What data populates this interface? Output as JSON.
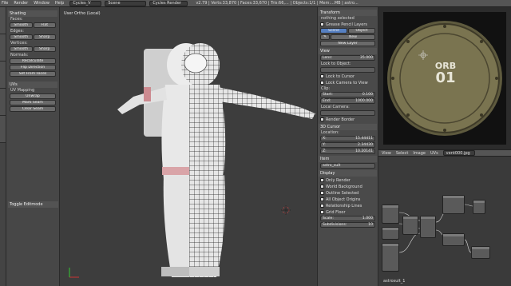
{
  "topbar": {
    "menus": [
      "File",
      "Render",
      "Window",
      "Help"
    ],
    "layout": "Cycles_V",
    "scene": "Scene",
    "engine": "Cycles Render",
    "info": "v2.79 | Verts:33,870 | Faces:33,670 | Tris:66,... | Objects:1/1 | Mem:...MB | astro..."
  },
  "toolshelf": {
    "shading_header": "Shading",
    "faces_label": "Faces:",
    "smooth": "Smooth",
    "flat": "Flat",
    "edges_label": "Edges:",
    "sharp": "Sharp",
    "vertices_label": "Vertices:",
    "normals_label": "Normals:",
    "recalculate": "Recalculate",
    "flip_direction": "Flip Direction",
    "set_from_faces": "Set From Faces",
    "uvs_header": "UVs",
    "uv_mapping": "UV Mapping",
    "unwrap": "Unwrap",
    "mark_seam": "Mark Seam",
    "clear_seam": "Clear Seam",
    "toggle_editmode": "Toggle Editmode"
  },
  "viewport": {
    "label": "User Ortho (Local)"
  },
  "props": {
    "transform": "Transform",
    "nothing_selected": "nothing selected",
    "grease_pencil": "Grease Pencil Layers",
    "scene_btn": "Scene",
    "object_btn": "Object",
    "new_btn": "New",
    "new_layer": "New Layer",
    "view": "View",
    "lens_label": "Lens:",
    "lens_value": "35.000",
    "lock_to_object": "Lock to Object:",
    "lock_to_cursor": "Lock to Cursor",
    "lock_camera_to_view": "Lock Camera to View",
    "clip": "Clip:",
    "start_label": "Start:",
    "start_value": "0.100",
    "end_label": "End:",
    "end_value": "1000.000",
    "local_camera": "Local Camera:",
    "render_border": "Render Border",
    "cursor_3d": "3D Cursor",
    "location": "Location:",
    "x_label": "X:",
    "x_value": "15.44411",
    "y_label": "Y:",
    "y_value": "2.34430",
    "z_label": "Z:",
    "z_value": "10.20141",
    "item": "Item",
    "item_name": "astro_suit",
    "display": "Display",
    "only_render": "Only Render",
    "world_background": "World Background",
    "outline_selected": "Outline Selected",
    "all_object_origins": "All Object Origins",
    "relationship_lines": "Relationship Lines",
    "grid_floor": "Grid Floor",
    "scale_label": "Scale:",
    "scale_value": "1.000",
    "subdivisions_label": "Subdivisions:",
    "subdivisions_value": "10"
  },
  "image_editor": {
    "orb_line1": "ORB",
    "orb_line2": "01",
    "menus": [
      "View",
      "Select",
      "Image",
      "UVs"
    ],
    "image_name": "vent000.jpg"
  },
  "node_editor": {
    "material_label": "astrosuit_1"
  }
}
